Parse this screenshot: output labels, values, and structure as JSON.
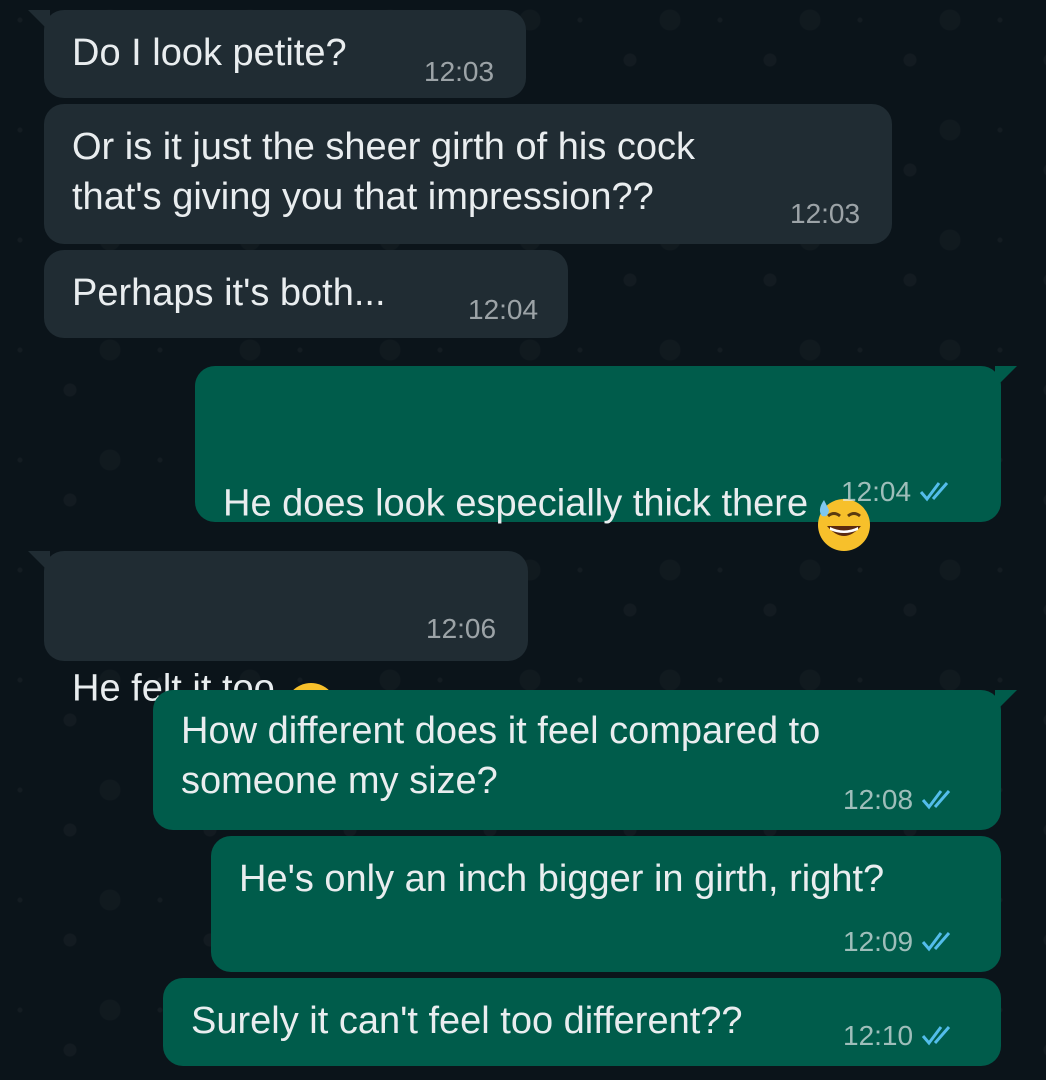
{
  "messages": [
    {
      "text": "Do I look petite?",
      "time": "12:03"
    },
    {
      "text": "Or is it just the sheer girth of his cock\nthat's giving you that impression??",
      "time": "12:03"
    },
    {
      "text": "Perhaps it's both...",
      "time": "12:04"
    },
    {
      "text": "He does look especially thick there",
      "time": "12:04",
      "emoji": "grinning-sweat-emoji"
    },
    {
      "text": "He felt it too",
      "time": "12:06",
      "emoji": "winking-tongue-emoji"
    },
    {
      "text": "How different does it feel compared to\nsomeone my size?",
      "time": "12:08"
    },
    {
      "text": "He's only an inch bigger in girth, right?",
      "time": "12:09"
    },
    {
      "text": "Surely it can't feel too different??",
      "time": "12:10"
    }
  ],
  "colors": {
    "background": "#0b141a",
    "incoming_bubble": "#202c33",
    "outgoing_bubble": "#005c4b",
    "read_ticks": "#53bdeb"
  }
}
